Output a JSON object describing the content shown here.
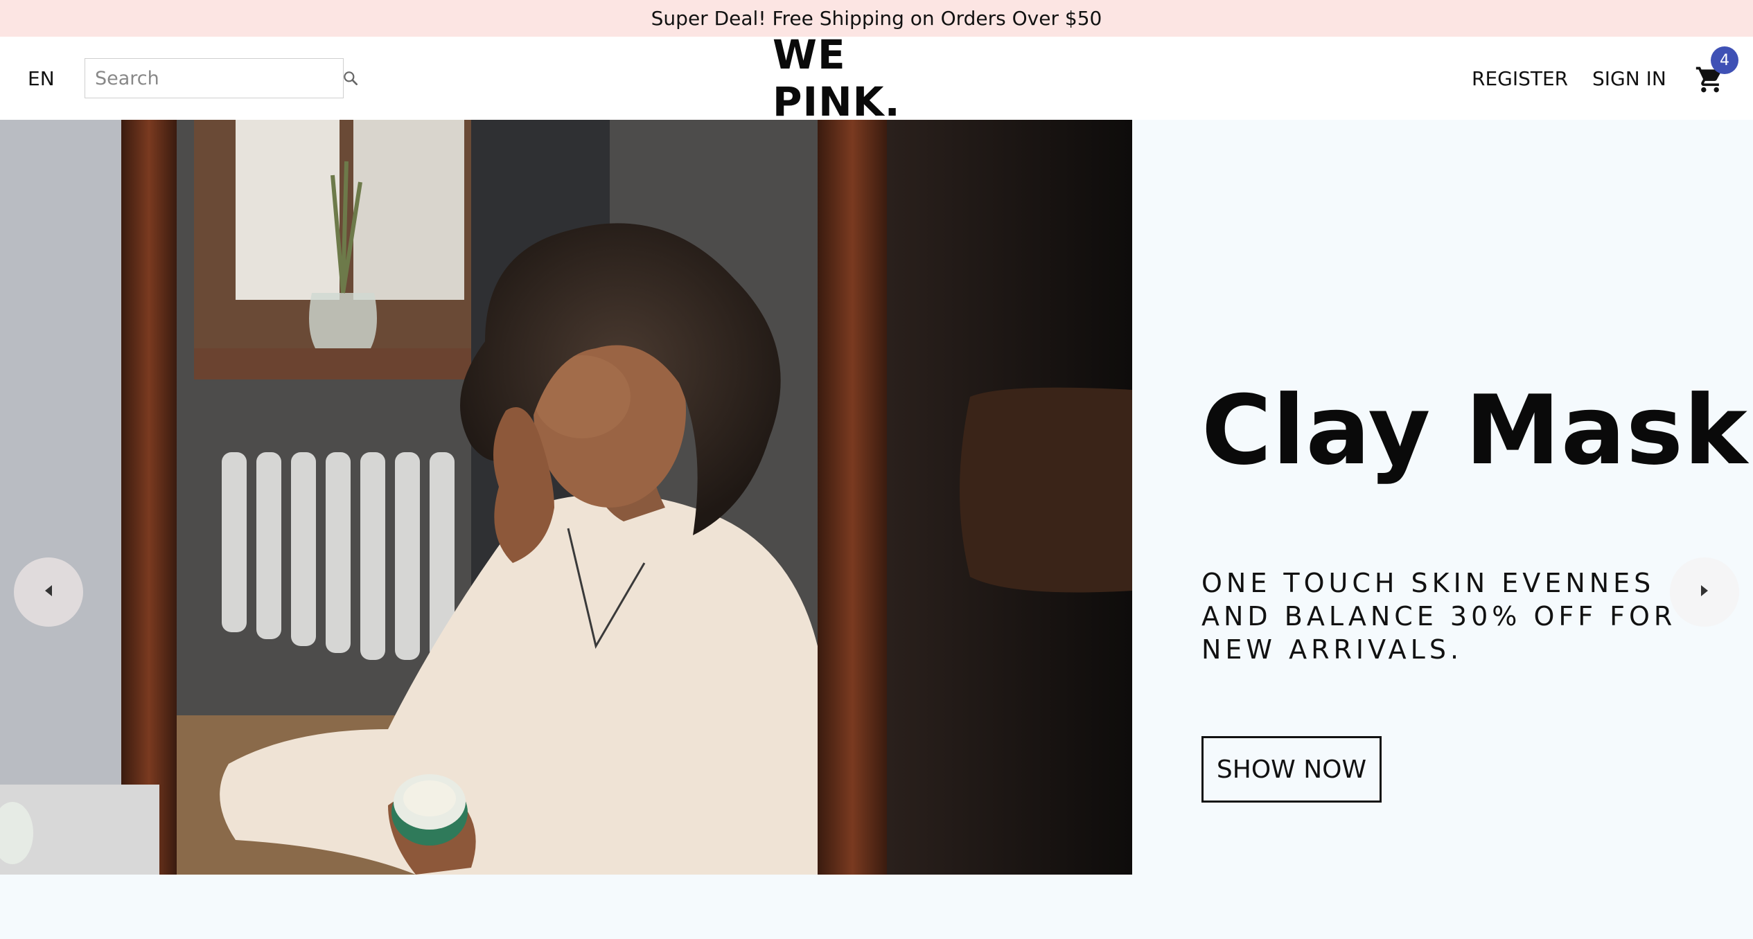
{
  "announcement": {
    "text": "Super Deal! Free Shipping on Orders Over $50"
  },
  "navbar": {
    "language": "EN",
    "search": {
      "placeholder": "Search",
      "value": "",
      "icon": "search-icon"
    },
    "logo": "WE PINK.",
    "register_label": "REGISTER",
    "signin_label": "SIGN IN",
    "cart": {
      "icon": "cart-icon",
      "count": "4",
      "badge_color": "#3f51b5"
    }
  },
  "slider": {
    "background": "#f5fafd",
    "left_arrow_icon": "arrow-left-icon",
    "right_arrow_icon": "arrow-right-icon",
    "slide": {
      "image": "woman-applying-cream-mirror",
      "title": "Clay Mask",
      "description": "ONE TOUCH SKIN EVENNES AND BALANCE 30% OFF FOR NEW ARRIVALS.",
      "button_label": "SHOW NOW"
    }
  },
  "colors": {
    "announcement_bg": "#fce5e3",
    "page_bg": "#f5fafd",
    "text": "#111111"
  }
}
